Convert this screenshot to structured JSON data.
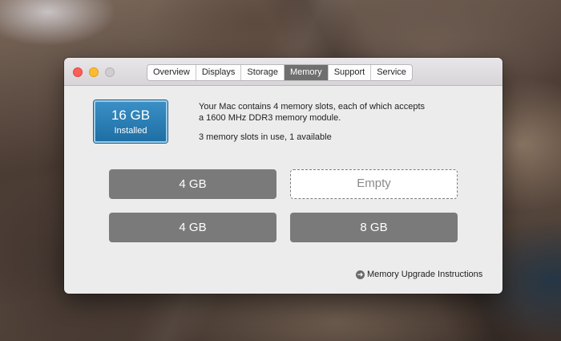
{
  "window": {
    "tabs": [
      {
        "label": "Overview",
        "active": false
      },
      {
        "label": "Displays",
        "active": false
      },
      {
        "label": "Storage",
        "active": false
      },
      {
        "label": "Memory",
        "active": true
      },
      {
        "label": "Support",
        "active": false
      },
      {
        "label": "Service",
        "active": false
      }
    ]
  },
  "memory": {
    "installed_size": "16 GB",
    "installed_label": "Installed",
    "description_line1": "Your Mac contains 4 memory slots, each of which accepts",
    "description_line2": "a 1600 MHz DDR3 memory module.",
    "slots_usage": "3 memory slots in use, 1 available",
    "slots": [
      {
        "label": "4 GB",
        "state": "filled"
      },
      {
        "label": "Empty",
        "state": "empty"
      },
      {
        "label": "4 GB",
        "state": "filled"
      },
      {
        "label": "8 GB",
        "state": "filled"
      }
    ],
    "upgrade_link": "Memory Upgrade Instructions"
  },
  "colors": {
    "badge_blue": "#2a7fb8",
    "slot_gray": "#7a7a7a",
    "active_tab": "#6f6f6f",
    "close": "#fc5f57",
    "minimize": "#fdbc2e",
    "zoom_disabled": "#cfcdcf"
  },
  "icons": {
    "upgrade_link_icon": "arrow-right-circle-icon"
  }
}
